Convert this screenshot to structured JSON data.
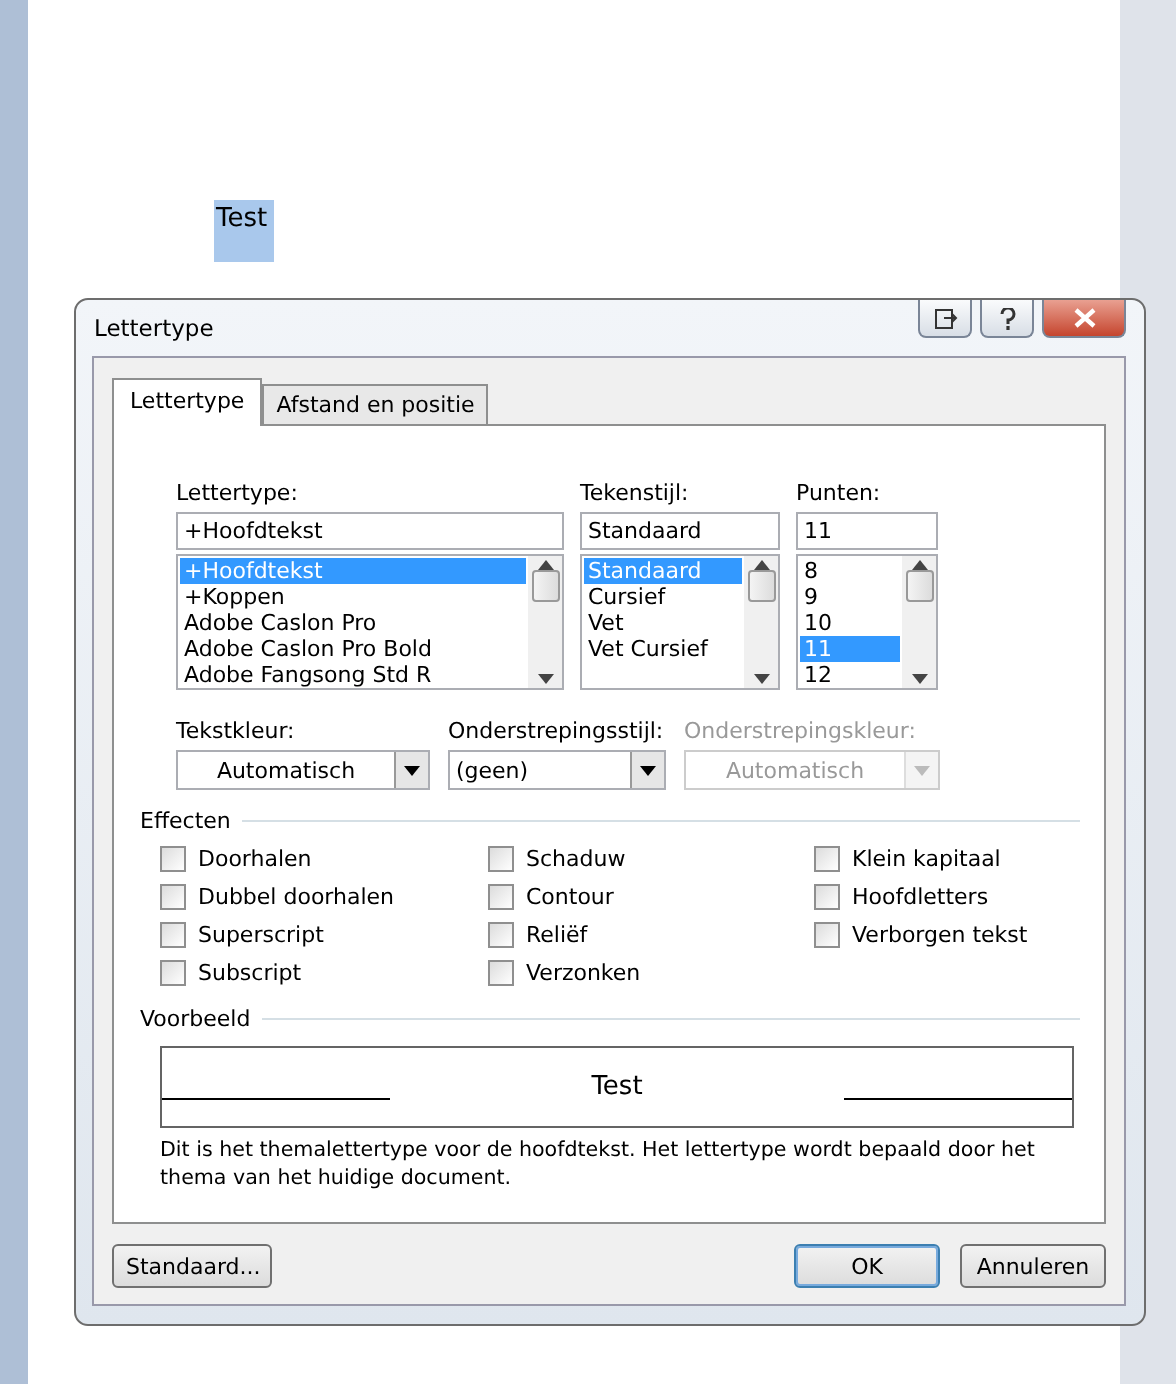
{
  "document": {
    "text": "Test",
    "selected": true
  },
  "window": {
    "title": "Lettertype"
  },
  "tabs": [
    {
      "label": "Lettertype",
      "selected": true
    },
    {
      "label": "Afstand en positie",
      "selected": false
    }
  ],
  "font": {
    "label": "Lettertype:",
    "value": "+Hoofdtekst",
    "items": [
      {
        "label": "+Hoofdtekst",
        "selected": true
      },
      {
        "label": "+Koppen",
        "selected": false
      },
      {
        "label": "Adobe Caslon Pro",
        "selected": false
      },
      {
        "label": "Adobe Caslon Pro Bold",
        "selected": false
      },
      {
        "label": "Adobe Fangsong Std R",
        "selected": false
      }
    ]
  },
  "style": {
    "label": "Tekenstijl:",
    "value": "Standaard",
    "items": [
      {
        "label": "Standaard",
        "selected": true
      },
      {
        "label": "Cursief",
        "selected": false
      },
      {
        "label": "Vet",
        "selected": false
      },
      {
        "label": "Vet Cursief",
        "selected": false
      }
    ]
  },
  "size": {
    "label": "Punten:",
    "value": "11",
    "items": [
      {
        "label": "8",
        "selected": false
      },
      {
        "label": "9",
        "selected": false
      },
      {
        "label": "10",
        "selected": false
      },
      {
        "label": "11",
        "selected": true
      },
      {
        "label": "12",
        "selected": false
      }
    ]
  },
  "dropdowns": [
    {
      "label": "Tekstkleur:",
      "value": "Automatisch",
      "disabled": false,
      "centered": true
    },
    {
      "label": "Onderstrepingsstijl:",
      "value": "(geen)",
      "disabled": false,
      "centered": false
    },
    {
      "label": "Onderstrepingskleur:",
      "value": "Automatisch",
      "disabled": true,
      "centered": true
    }
  ],
  "effects": {
    "title": "Effecten",
    "columns": [
      [
        {
          "label": "Doorhalen",
          "checked": false
        },
        {
          "label": "Dubbel doorhalen",
          "checked": false
        },
        {
          "label": "Superscript",
          "checked": false
        },
        {
          "label": "Subscript",
          "checked": false
        }
      ],
      [
        {
          "label": "Schaduw",
          "checked": false
        },
        {
          "label": "Contour",
          "checked": false
        },
        {
          "label": "Reliëf",
          "checked": false
        },
        {
          "label": "Verzonken",
          "checked": false
        }
      ],
      [
        {
          "label": "Klein kapitaal",
          "checked": false
        },
        {
          "label": "Hoofdletters",
          "checked": false
        },
        {
          "label": "Verborgen tekst",
          "checked": false
        }
      ]
    ]
  },
  "preview": {
    "title": "Voorbeeld",
    "sample": "Test",
    "description": "Dit is het themalettertype voor de hoofdtekst. Het lettertype wordt bepaald door het thema van het huidige document."
  },
  "buttons": {
    "default": "Standaard...",
    "ok": "OK",
    "cancel": "Annuleren"
  }
}
